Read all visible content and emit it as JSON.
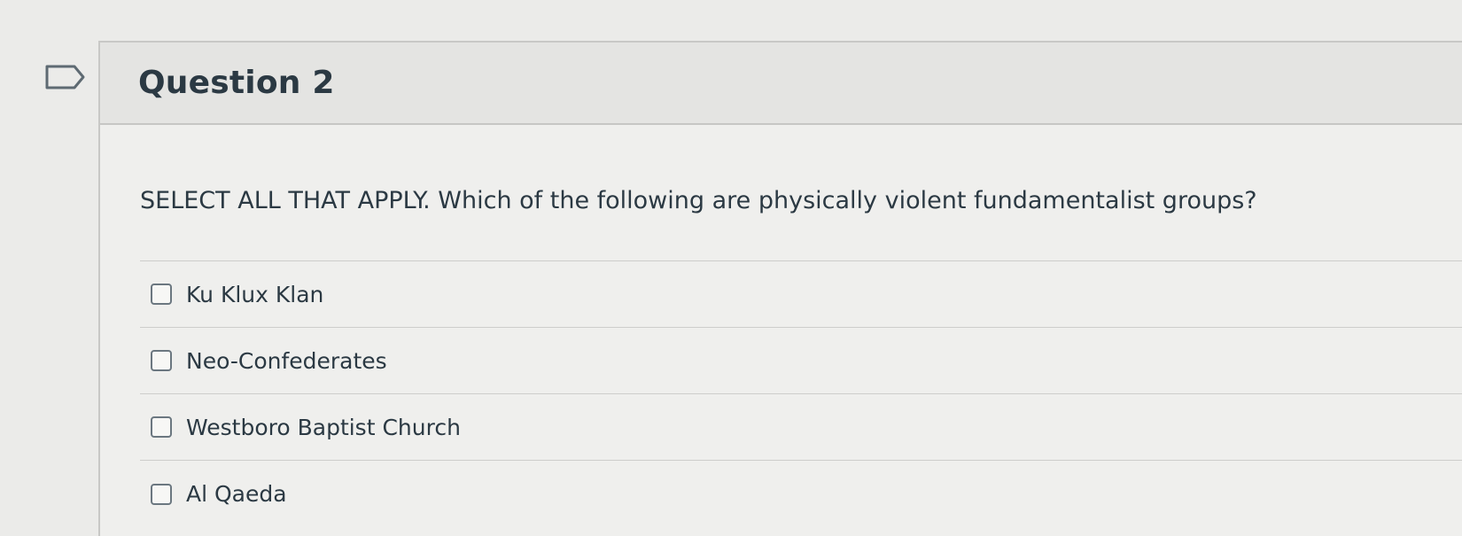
{
  "question": {
    "title": "Question 2",
    "text": "SELECT ALL THAT APPLY. Which of the following are physically violent fundamentalist groups?",
    "answers": [
      {
        "label": "Ku Klux Klan",
        "checked": false
      },
      {
        "label": "Neo-Confederates",
        "checked": false
      },
      {
        "label": "Westboro Baptist Church",
        "checked": false
      },
      {
        "label": "Al Qaeda",
        "checked": false
      }
    ]
  },
  "icons": {
    "bookmark": "bookmark-flag-icon"
  },
  "colors": {
    "background": "#ebebe9",
    "header": "#e4e4e2",
    "text": "#2b3943",
    "border": "#c8c8c6"
  }
}
